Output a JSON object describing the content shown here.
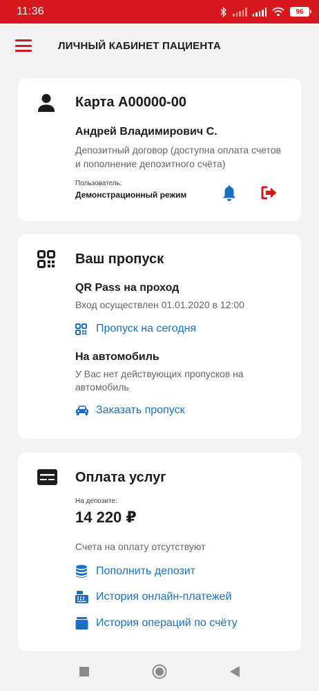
{
  "status": {
    "time": "11:36",
    "battery": "96"
  },
  "header": {
    "title": "ЛИЧНЫЙ КАБИНЕТ ПАЦИЕНТА"
  },
  "card_account": {
    "title": "Карта A00000-00",
    "name": "Андрей Владимирович С.",
    "contract_line1": "Депозитный договор (доступна оплата счетов",
    "contract_line2": "и пополнение депозитного счёта)",
    "user_label": "Пользователь:",
    "user_mode": "Демонстрационный режим"
  },
  "card_pass": {
    "title": "Ваш пропуск",
    "qr_title": "QR Pass на проход",
    "qr_status": "Вход осуществлен 01.01.2020 в 12:00",
    "today_link": "Пропуск на сегодня",
    "car_title": "На автомобиль",
    "car_status_line1": "У Вас нет действующих пропусков на",
    "car_status_line2": "автомобиль",
    "order_link": "Заказать пропуск"
  },
  "card_payment": {
    "title": "Оплата услуг",
    "deposit_label": "На депозите:",
    "deposit_amount": "14 220 ₽",
    "bills_status": "Счета на оплату отсутствуют",
    "topup_link": "Пополнить депозит",
    "online_history_link": "История онлайн-платежей",
    "account_history_link": "История операций по счёту"
  },
  "icons": {
    "menu": "hamburger-menu-icon",
    "user": "person-icon",
    "notifications": "bell-icon",
    "logout": "logout-icon",
    "qr": "qr-code-icon",
    "car": "car-icon",
    "card": "payment-card-icon",
    "coins": "coins-icon",
    "register": "cash-register-icon",
    "wallet": "wallet-icon"
  },
  "colors": {
    "accent": "#d6171c",
    "link": "#1a6fc4",
    "text": "#1c1c1c",
    "secondary": "#646464",
    "background": "#f3f2f5"
  }
}
